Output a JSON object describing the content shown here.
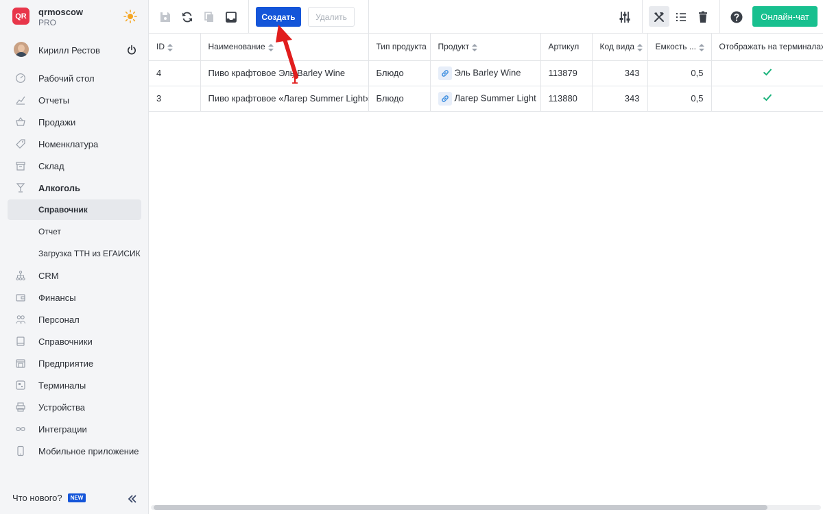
{
  "brand": {
    "logo_text": "QR",
    "name": "qrmoscow",
    "plan": "PRO"
  },
  "user": {
    "name": "Кирилл Рестов"
  },
  "nav": {
    "items": [
      {
        "label": "Рабочий стол",
        "icon": "speedometer-icon"
      },
      {
        "label": "Отчеты",
        "icon": "chart-icon"
      },
      {
        "label": "Продажи",
        "icon": "basket-icon"
      },
      {
        "label": "Номенклатура",
        "icon": "tag-icon"
      },
      {
        "label": "Склад",
        "icon": "archive-icon"
      },
      {
        "label": "Алкоголь",
        "icon": "glass-icon"
      }
    ],
    "sub_items": [
      {
        "label": "Справочник"
      },
      {
        "label": "Отчет"
      },
      {
        "label": "Загрузка ТТН из ЕГАИСИК"
      }
    ],
    "items_after": [
      {
        "label": "CRM",
        "icon": "hierarchy-icon"
      },
      {
        "label": "Финансы",
        "icon": "wallet-icon"
      },
      {
        "label": "Персонал",
        "icon": "people-icon"
      },
      {
        "label": "Справочники",
        "icon": "book-icon"
      },
      {
        "label": "Предприятие",
        "icon": "store-icon"
      },
      {
        "label": "Терминалы",
        "icon": "qr-icon"
      },
      {
        "label": "Устройства",
        "icon": "printer-icon"
      },
      {
        "label": "Интеграции",
        "icon": "infinity-icon"
      },
      {
        "label": "Мобильное приложение",
        "icon": "phone-icon"
      }
    ]
  },
  "footer": {
    "whats_new": "Что нового?",
    "new_badge": "NEW"
  },
  "toolbar": {
    "create_label": "Создать",
    "delete_label": "Удалить",
    "chat_label": "Онлайн-чат"
  },
  "table": {
    "columns": [
      "ID",
      "Наименование",
      "Тип продукта",
      "Продукт",
      "Артикул",
      "Код вида",
      "Емкость ...",
      "Отображать на терминалах"
    ],
    "rows": [
      {
        "id": "4",
        "name": "Пиво крафтовое Эль Barley Wine",
        "type": "Блюдо",
        "product": "Эль Barley Wine",
        "article": "113879",
        "kind_code": "343",
        "capacity": "0,5",
        "show": true
      },
      {
        "id": "3",
        "name": "Пиво крафтовое «Лагер Summer Light»",
        "type": "Блюдо",
        "product": "Лагер Summer Light",
        "article": "113880",
        "kind_code": "343",
        "capacity": "0,5",
        "show": true
      }
    ]
  },
  "annotation": {
    "step": "1"
  },
  "colors": {
    "primary": "#1455d9",
    "accent_green": "#18c08f",
    "check": "#18b27a",
    "annotation": "#e11d1d",
    "logo": "#e8364a"
  }
}
